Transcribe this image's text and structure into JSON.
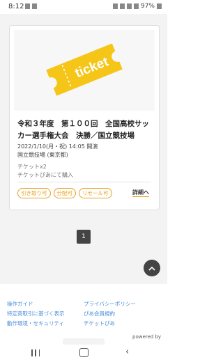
{
  "status_bar": {
    "time": "8:12",
    "battery": "97%"
  },
  "card": {
    "ticket_image_text": "ticket",
    "title": "令和３年度　第１００回　全国高校サッカー選手権大会　決勝／国立競技場",
    "datetime": "2022/1/10(月・祝) 14:05 開演",
    "venue": "国立競技場 (東京都)",
    "ticket_count": "チケットx2",
    "purchase_method": "チケットぴあにて購入",
    "badges": [
      "引き取り可",
      "分配可",
      "リセール可"
    ],
    "details_link": "詳細へ"
  },
  "pagination": {
    "current_page": "1"
  },
  "footer": {
    "links": [
      "操作ガイド",
      "プライバシーポリシー",
      "特定商取引に基づく表示",
      "ぴあ会員規約",
      "動作環境・セキュリティ",
      "チケットぴあ"
    ],
    "powered_by": "powered by"
  },
  "colors": {
    "accent": "#e8a020",
    "ticket_yellow": "#f5c518",
    "link_blue": "#4a8ed8",
    "dark": "#444444"
  }
}
